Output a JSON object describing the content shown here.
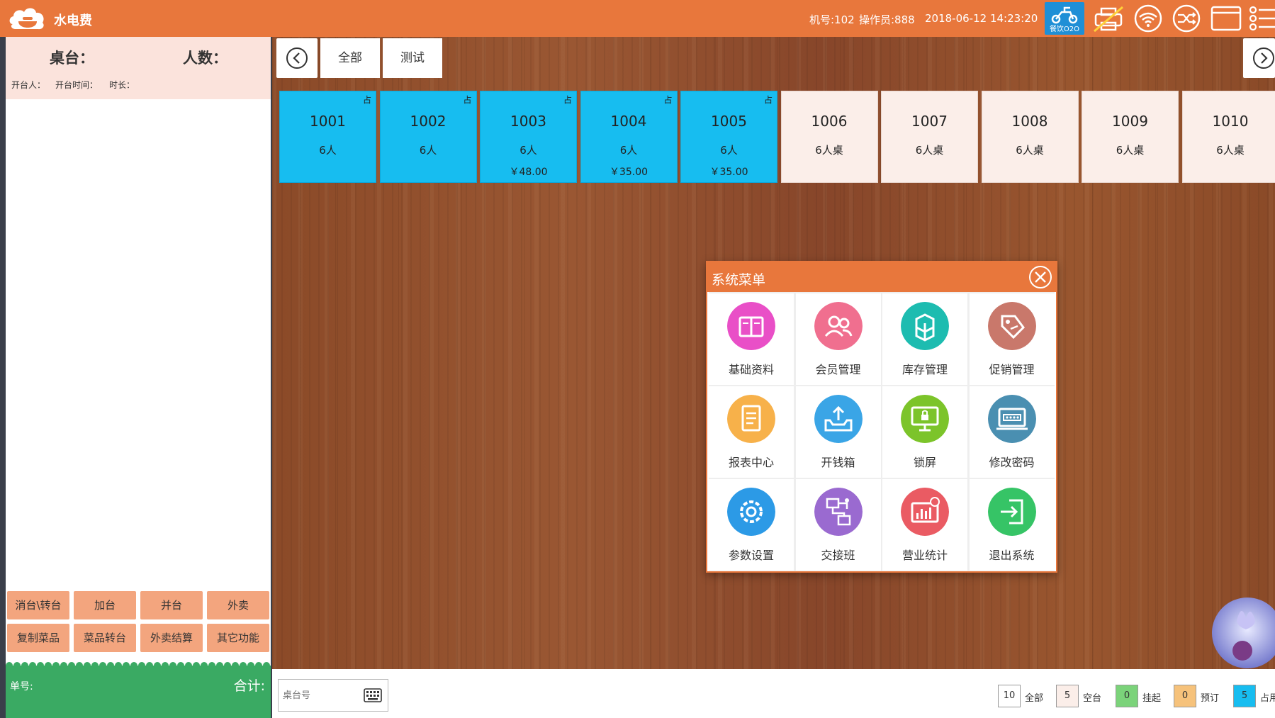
{
  "header": {
    "app_title": "水电费",
    "machine": "机号:102",
    "operator": "操作员:888",
    "datetime": "2018-06-12 14:23:20",
    "o2o_label": "餐饮O2O",
    "icons": [
      "printer-icon",
      "wifi-icon",
      "shuffle-icon",
      "window-icon",
      "menu-list-icon"
    ]
  },
  "left_panel": {
    "table_label": "桌台：",
    "people_label": "人数：",
    "opener_label": "开台人：",
    "open_time_label": "开台时间：",
    "duration_label": "时长：",
    "buttons": [
      "消台\\转台",
      "加台",
      "并台",
      "外卖",
      "复制菜品",
      "菜品转台",
      "外卖结算",
      "其它功能"
    ],
    "order_label": "单号:",
    "total_label": "合计:"
  },
  "categories": [
    "全部",
    "测试"
  ],
  "tables": [
    {
      "no": "1001",
      "cap": "6人",
      "amt": "",
      "occ": "占",
      "occupied": true
    },
    {
      "no": "1002",
      "cap": "6人",
      "amt": "",
      "occ": "占",
      "occupied": true
    },
    {
      "no": "1003",
      "cap": "6人",
      "amt": "￥48.00",
      "occ": "占",
      "occupied": true
    },
    {
      "no": "1004",
      "cap": "6人",
      "amt": "￥35.00",
      "occ": "占",
      "occupied": true
    },
    {
      "no": "1005",
      "cap": "6人",
      "amt": "￥35.00",
      "occ": "占",
      "occupied": true
    },
    {
      "no": "1006",
      "cap": "6人桌",
      "amt": "",
      "occ": "",
      "occupied": false
    },
    {
      "no": "1007",
      "cap": "6人桌",
      "amt": "",
      "occ": "",
      "occupied": false
    },
    {
      "no": "1008",
      "cap": "6人桌",
      "amt": "",
      "occ": "",
      "occupied": false
    },
    {
      "no": "1009",
      "cap": "6人桌",
      "amt": "",
      "occ": "",
      "occupied": false
    },
    {
      "no": "1010",
      "cap": "6人桌",
      "amt": "",
      "occ": "",
      "occupied": false
    }
  ],
  "system_menu": {
    "title": "系统菜单",
    "items": [
      {
        "label": "基础资料",
        "icon": "book-icon",
        "color": "#e94fc7"
      },
      {
        "label": "会员管理",
        "icon": "members-icon",
        "color": "#f06f8f"
      },
      {
        "label": "库存管理",
        "icon": "boxes-icon",
        "color": "#1dbcb0"
      },
      {
        "label": "促销管理",
        "icon": "tag-icon",
        "color": "#c9786b"
      },
      {
        "label": "报表中心",
        "icon": "report-icon",
        "color": "#f7b14a"
      },
      {
        "label": "开钱箱",
        "icon": "cashbox-icon",
        "color": "#3aa5e6"
      },
      {
        "label": "锁屏",
        "icon": "lock-screen-icon",
        "color": "#7cc42a"
      },
      {
        "label": "修改密码",
        "icon": "password-icon",
        "color": "#4a8fb1"
      },
      {
        "label": "参数设置",
        "icon": "gear-icon",
        "color": "#2c9ae6"
      },
      {
        "label": "交接班",
        "icon": "network-icon",
        "color": "#9a6ad0"
      },
      {
        "label": "营业统计",
        "icon": "chart-icon",
        "color": "#ea5b63"
      },
      {
        "label": "退出系统",
        "icon": "exit-icon",
        "color": "#36c466"
      }
    ]
  },
  "bottom": {
    "tableno_placeholder": "桌台号",
    "legend": [
      {
        "count": "10",
        "label": "全部",
        "color": "#ffffff"
      },
      {
        "count": "5",
        "label": "空台",
        "color": "#fbeee9"
      },
      {
        "count": "0",
        "label": "挂起",
        "color": "#7bd37a"
      },
      {
        "count": "0",
        "label": "预订",
        "color": "#f6c27b"
      },
      {
        "count": "5",
        "label": "占用",
        "color": "#17bdf0"
      }
    ]
  },
  "colors": {
    "accent": "#e8773c",
    "occupied": "#17bdf0",
    "footer_green": "#3aaa63",
    "button_orange": "#f3a57e"
  }
}
